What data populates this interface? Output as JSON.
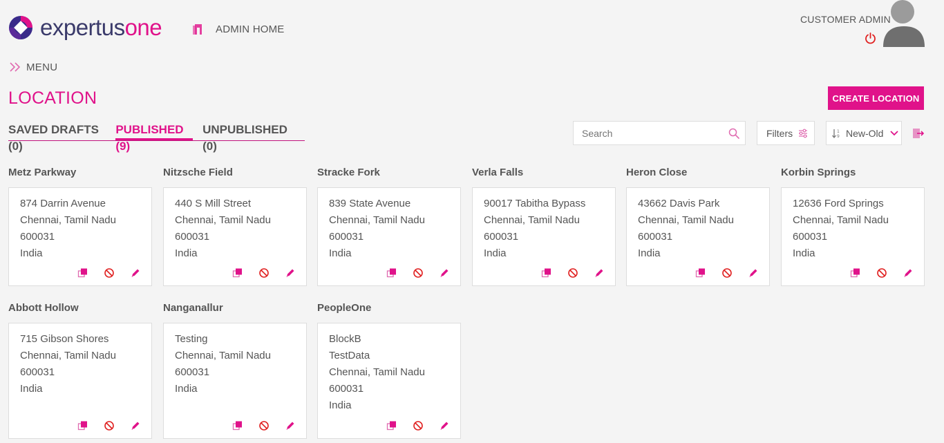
{
  "header": {
    "logo_left": "expertus",
    "logo_right": "one",
    "admin_home": "ADMIN HOME",
    "user_role": "CUSTOMER ADMIN"
  },
  "menu": {
    "label": "MENU"
  },
  "page": {
    "title": "LOCATION",
    "create_label": "CREATE LOCATION"
  },
  "tabs": [
    {
      "label": "SAVED DRAFTS (0)",
      "active": false
    },
    {
      "label": "PUBLISHED (9)",
      "active": true
    },
    {
      "label": "UNPUBLISHED (0)",
      "active": false
    }
  ],
  "toolbar": {
    "search_placeholder": "Search",
    "filters_label": "Filters",
    "sort_value": "New-Old"
  },
  "locations": [
    {
      "name": "Metz Parkway",
      "lines": [
        "874 Darrin Avenue",
        "Chennai, Tamil Nadu",
        "600031",
        "India"
      ]
    },
    {
      "name": "Nitzsche Field",
      "lines": [
        "440 S Mill Street",
        "Chennai, Tamil Nadu",
        "600031",
        "India"
      ]
    },
    {
      "name": "Stracke Fork",
      "lines": [
        "839 State Avenue",
        "Chennai, Tamil Nadu",
        "600031",
        "India"
      ]
    },
    {
      "name": "Verla Falls",
      "lines": [
        "90017 Tabitha Bypass",
        "Chennai, Tamil Nadu",
        "600031",
        "India"
      ]
    },
    {
      "name": "Heron Close",
      "lines": [
        "43662 Davis Park",
        "Chennai, Tamil Nadu",
        "600031",
        "India"
      ]
    },
    {
      "name": "Korbin Springs",
      "lines": [
        "12636 Ford Springs",
        "Chennai, Tamil Nadu",
        "600031",
        "India"
      ]
    },
    {
      "name": "Abbott Hollow",
      "lines": [
        "715 Gibson Shores",
        "Chennai, Tamil Nadu",
        "600031",
        "India"
      ]
    },
    {
      "name": "Nanganallur",
      "lines": [
        "Testing",
        "Chennai, Tamil Nadu",
        "600031",
        "India"
      ]
    },
    {
      "name": "PeopleOne",
      "lines": [
        "BlockB",
        "TestData",
        "Chennai, Tamil Nadu",
        "600031",
        "India"
      ]
    }
  ],
  "colors": {
    "accent": "#e0128a",
    "text": "#555555",
    "background": "#f4f4f4",
    "card_border": "#dddddd"
  },
  "icons": {
    "card_actions": [
      "copy-icon",
      "unpublish-icon",
      "edit-icon"
    ]
  }
}
